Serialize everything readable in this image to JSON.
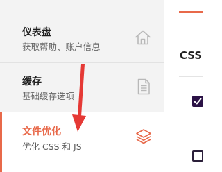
{
  "sidebar": {
    "items": [
      {
        "title": "仪表盘",
        "description": "获取帮助、账户信息",
        "icon": "home-icon"
      },
      {
        "title": "缓存",
        "description": "基础缓存选项",
        "icon": "document-icon"
      },
      {
        "title": "文件优化",
        "description": "优化 CSS 和 JS",
        "icon": "layers-icon",
        "active": true
      }
    ]
  },
  "main": {
    "section_heading": "CSS",
    "checkboxes": [
      {
        "checked": true
      },
      {
        "checked": false
      }
    ]
  },
  "colors": {
    "accent": "#e8694a",
    "annotation_arrow": "#e53935",
    "checkbox_fill": "#2b1246",
    "sidebar_bg": "#f3f3f3"
  }
}
